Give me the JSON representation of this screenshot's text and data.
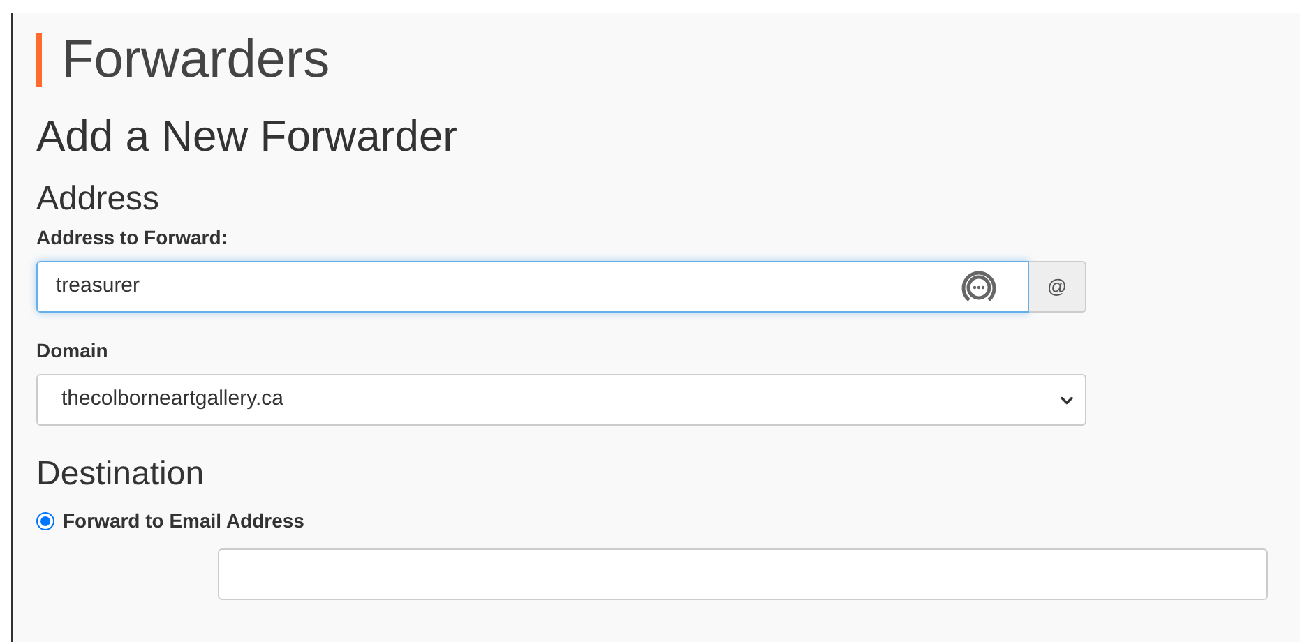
{
  "page_title": "Forwarders",
  "section_title": "Add a New Forwarder",
  "address": {
    "heading": "Address",
    "field_label": "Address to Forward:",
    "value": "treasurer",
    "addon": "@",
    "focused": true
  },
  "domain": {
    "label": "Domain",
    "value": "thecolborneartgallery.ca"
  },
  "destination": {
    "heading": "Destination",
    "options": [
      {
        "label": "Forward to Email Address",
        "selected": true
      }
    ]
  }
}
